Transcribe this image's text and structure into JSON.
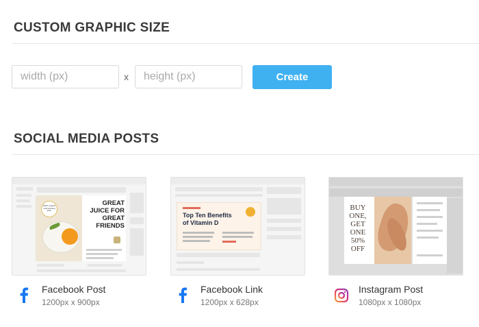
{
  "custom": {
    "title": "CUSTOM GRAPHIC SIZE",
    "width_placeholder": "width (px)",
    "separator": "x",
    "height_placeholder": "height (px)",
    "create_label": "Create"
  },
  "social": {
    "title": "SOCIAL MEDIA POSTS",
    "cards": [
      {
        "title": "Facebook Post",
        "size": "1200px x 900px",
        "icon": "facebook-icon",
        "preview": {
          "badge": "100% organic cold-pressed juice",
          "headline_lines": [
            "GREAT",
            "JUICE FOR",
            "GREAT",
            "FRIENDS"
          ]
        }
      },
      {
        "title": "Facebook Link",
        "size": "1200px x 628px",
        "icon": "facebook-icon",
        "preview": {
          "headline_lines": [
            "Top Ten Benefits",
            "of Vitamin D"
          ]
        }
      },
      {
        "title": "Instagram Post",
        "size": "1080px x 1080px",
        "icon": "instagram-icon",
        "preview": {
          "offer_lines": [
            "BUY",
            "ONE,",
            "GET",
            "ONE",
            "50%",
            "OFF"
          ]
        }
      }
    ]
  },
  "colors": {
    "accent": "#3fb1f1",
    "facebook": "#1877f2",
    "orange": "#f39a1e"
  }
}
